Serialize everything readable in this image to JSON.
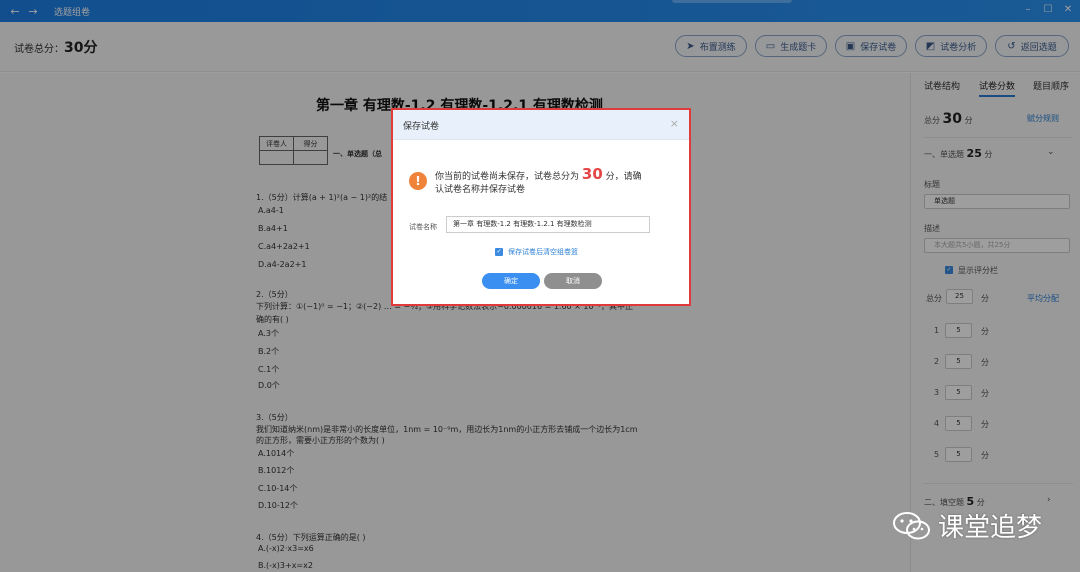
{
  "window": {
    "title": "选题组卷",
    "back_icon": "←",
    "forward_icon": "→",
    "min_icon": "–",
    "max_icon": "☐",
    "close_icon": "✕"
  },
  "toolbar": {
    "total_label": "试卷总分：",
    "total_value": "30分",
    "buttons": [
      {
        "icon": "➤",
        "label": "布置测练"
      },
      {
        "icon": "▭",
        "label": "生成题卡"
      },
      {
        "icon": "▣",
        "label": "保存试卷"
      },
      {
        "icon": "◩",
        "label": "试卷分析"
      },
      {
        "icon": "↺",
        "label": "返回选题"
      }
    ]
  },
  "document": {
    "title": "第一章 有理数-1.2 有理数-1.2.1 有理数检测",
    "table_headers": [
      "评卷人",
      "得分"
    ],
    "section1": "一、单选题（总",
    "questions": [
      {
        "stem": "1.（5分）计算(a + 1)²(a − 1)²的结",
        "options": [
          "A.a4-1",
          "B.a4+1",
          "C.a4+2a2+1",
          "D.a4-2a2+1"
        ]
      },
      {
        "stem": "2.（5分）",
        "stem2": "下列计算：①(−1)⁰ = −1；②(−2) … = −¼；③用科学记数法表示−0.000016 = 1.60 × 10⁻⁵，其中正",
        "stem3": "确的有(     )",
        "options": [
          "A.3个",
          "B.2个",
          "C.1个",
          "D.0个"
        ]
      },
      {
        "stem": "3.（5分）",
        "stem2": "我们知道纳米(nm)是非常小的长度单位，1nm = 10⁻⁹m，用边长为1nm的小正方形去铺成一个边长为1cm",
        "stem3": "的正方形，需要小正方形的个数为(     )",
        "options": [
          "A.1014个",
          "B.1012个",
          "C.10-14个",
          "D.10-12个"
        ]
      },
      {
        "stem": "4.（5分）下列运算正确的是(     )",
        "options": [
          "A.(-x)2·x3=x6",
          "B.(-x)3+x=x2"
        ]
      }
    ]
  },
  "sidebar": {
    "tabs": [
      "试卷结构",
      "试卷分数",
      "题目顺序"
    ],
    "total_prefix": "总分",
    "total_value": "30",
    "total_unit": "分",
    "rule_link": "赋分规则",
    "section1_label": "一、单选题",
    "section1_score": "25",
    "section1_unit": "分",
    "title_label": "标题",
    "title_value": "单选题",
    "desc_label": "描述",
    "desc_placeholder": "本大题共5小题，共25分",
    "show_score_bar": "显示评分栏",
    "total_score_label": "总分",
    "total_score_value": "25",
    "total_score_unit": "分",
    "avg_link": "平均分配",
    "items": [
      {
        "no": "1",
        "score": "5",
        "unit": "分"
      },
      {
        "no": "2",
        "score": "5",
        "unit": "分"
      },
      {
        "no": "3",
        "score": "5",
        "unit": "分"
      },
      {
        "no": "4",
        "score": "5",
        "unit": "分"
      },
      {
        "no": "5",
        "score": "5",
        "unit": "分"
      }
    ],
    "section2_label": "二、填空题",
    "section2_score": "5",
    "section2_unit": "分"
  },
  "dialog": {
    "title": "保存试卷",
    "close": "×",
    "warn_icon": "!",
    "message_pre": "你当前的试卷尚未保存，试卷总分为",
    "message_score": "30",
    "message_post": "分，请确",
    "message_line2": "认试卷名称并保存试卷",
    "name_label": "试卷名称",
    "name_value": "第一章 有理数-1.2 有理数-1.2.1 有理数检测",
    "checkbox_label": "保存试卷后清空组卷篮",
    "ok": "确定",
    "cancel": "取消"
  },
  "watermark": {
    "text": "课堂追梦"
  },
  "colors": {
    "accent": "#2a7fd4",
    "titlebar": "#1d7fe6",
    "dialog_border": "#e03a3a",
    "score_red": "#e64545",
    "warn_orange": "#f0833a"
  }
}
